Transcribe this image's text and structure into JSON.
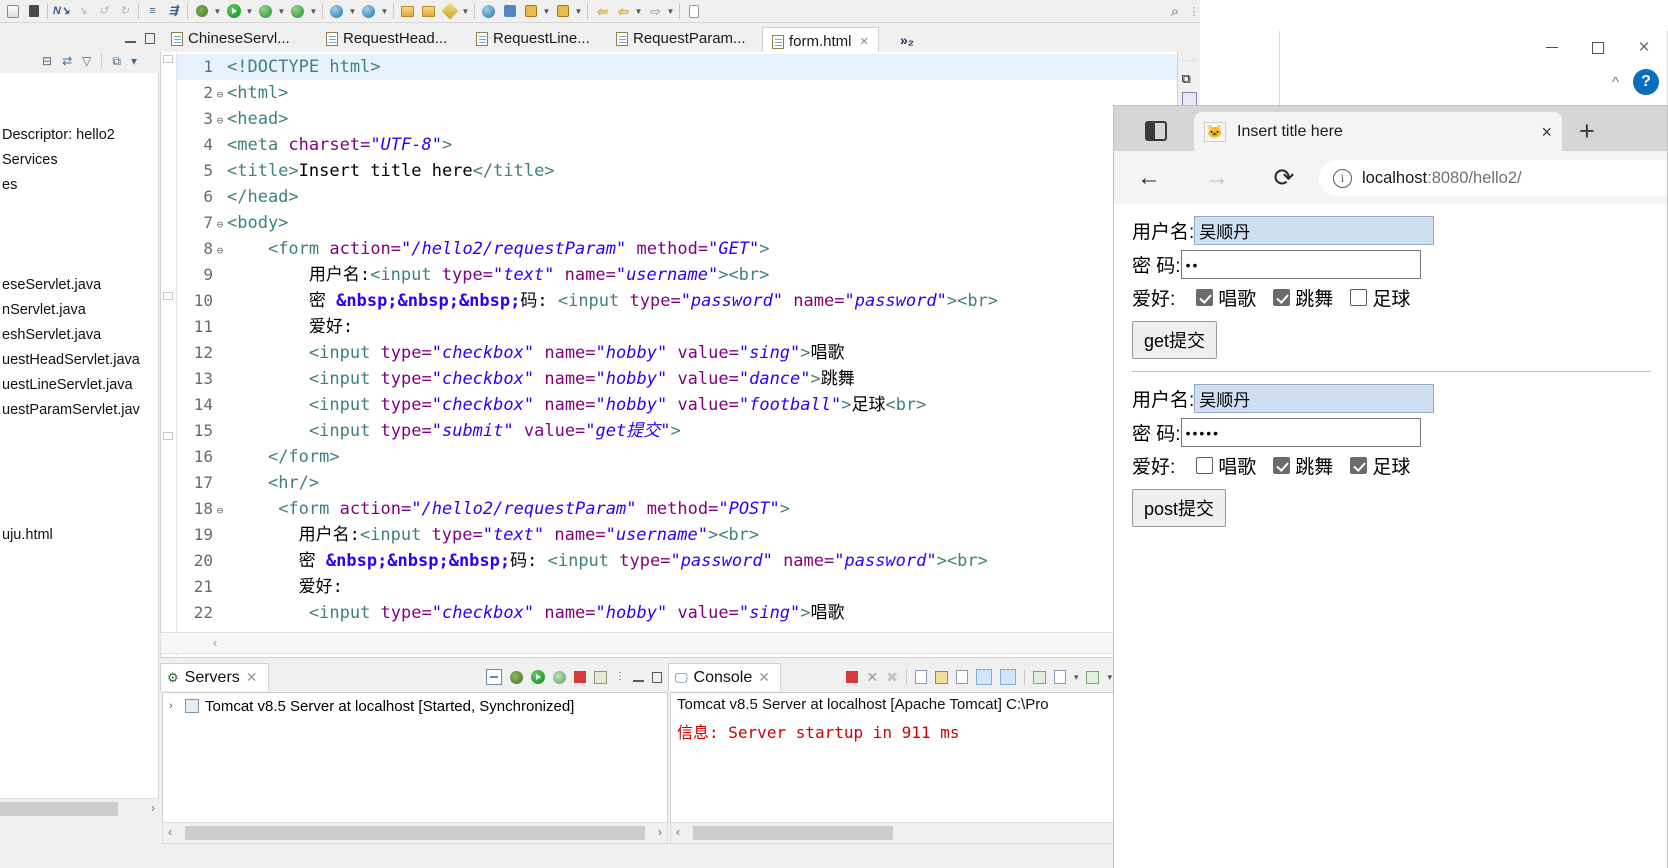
{
  "eclipse": {
    "toolbar": {
      "icons": [
        {
          "name": "restore-icon",
          "glyph": "bar"
        },
        {
          "name": "save-icon",
          "glyph": "dark"
        },
        {
          "name": "next-annotation-icon",
          "glyph": "nav"
        },
        {
          "name": "previous-annotation-icon",
          "glyph": "dis"
        },
        {
          "name": "undo-icon",
          "glyph": "dis"
        },
        {
          "name": "redo-icon",
          "glyph": "dis"
        },
        {
          "name": "open-task-icon",
          "glyph": "nav"
        },
        {
          "name": "skip-breakpoints-icon",
          "glyph": "nav"
        },
        {
          "name": "debug-icon",
          "glyph": "bug"
        },
        {
          "name": "run-icon",
          "glyph": "run"
        },
        {
          "name": "coverage-icon",
          "glyph": "green"
        },
        {
          "name": "profile-icon",
          "glyph": "green"
        },
        {
          "name": "new-server-icon",
          "glyph": "globe"
        },
        {
          "name": "web-browser-icon",
          "glyph": "globe"
        },
        {
          "name": "open-type-icon",
          "glyph": "folder"
        },
        {
          "name": "open-task-folder-icon",
          "glyph": "folder"
        },
        {
          "name": "edit-icon",
          "glyph": "pencil"
        },
        {
          "name": "search-globe-icon",
          "glyph": "globe"
        },
        {
          "name": "person-run-icon",
          "glyph": "blue"
        },
        {
          "name": "download-icon",
          "glyph": "yellow"
        },
        {
          "name": "upload-icon",
          "glyph": "yellow"
        },
        {
          "name": "back-history-icon",
          "glyph": "arrowL"
        },
        {
          "name": "forward-history-icon",
          "glyph": "arrowL"
        },
        {
          "name": "next-edit-icon",
          "glyph": "arrowG"
        },
        {
          "name": "new-window-icon",
          "glyph": "doc"
        }
      ],
      "search_icon": "search-icon",
      "overflow_dots": "⋮"
    },
    "explorer": {
      "rows": [
        "",
        "",
        "Descriptor: hello2",
        " Services",
        "es",
        "",
        "",
        "",
        "eseServlet.java",
        "nServlet.java",
        "eshServlet.java",
        "uestHeadServlet.java",
        "uestLineServlet.java",
        "uestParamServlet.jav",
        "",
        "",
        "",
        "",
        "uju.html"
      ]
    },
    "editor": {
      "tabs": [
        {
          "label": "ChineseServl...",
          "active": false,
          "close": false
        },
        {
          "label": "RequestHead...",
          "active": false,
          "close": false
        },
        {
          "label": "RequestLine...",
          "active": false,
          "close": false
        },
        {
          "label": "RequestParam...",
          "active": false,
          "close": false
        },
        {
          "label": "form.html",
          "active": true,
          "close": true
        }
      ],
      "more_tabs_label": "»₂",
      "lines": [
        {
          "no": "1",
          "fold": "",
          "current": true,
          "parts": [
            {
              "t": "dtd",
              "s": "<!DOCTYPE html>"
            }
          ]
        },
        {
          "no": "2",
          "fold": "⊖",
          "current": false,
          "parts": [
            {
              "t": "tag",
              "s": "<html>"
            }
          ]
        },
        {
          "no": "3",
          "fold": "⊖",
          "current": false,
          "parts": [
            {
              "t": "tag",
              "s": "<head>"
            }
          ]
        },
        {
          "no": "4",
          "fold": "",
          "current": false,
          "parts": [
            {
              "t": "tag",
              "s": "<meta "
            },
            {
              "t": "attr",
              "s": "charset="
            },
            {
              "t": "val",
              "s": "\"UTF-8\""
            },
            {
              "t": "tag",
              "s": ">"
            }
          ]
        },
        {
          "no": "5",
          "fold": "",
          "current": false,
          "parts": [
            {
              "t": "tag",
              "s": "<title>"
            },
            {
              "t": "txt",
              "s": "Insert title here"
            },
            {
              "t": "tag",
              "s": "</title>"
            }
          ]
        },
        {
          "no": "6",
          "fold": "",
          "current": false,
          "parts": [
            {
              "t": "tag",
              "s": "</head>"
            }
          ]
        },
        {
          "no": "7",
          "fold": "⊖",
          "current": false,
          "parts": [
            {
              "t": "tag",
              "s": "<body>"
            }
          ]
        },
        {
          "no": "8",
          "fold": "⊖",
          "current": false,
          "parts": [
            {
              "t": "txt",
              "s": "    "
            },
            {
              "t": "tag",
              "s": "<form "
            },
            {
              "t": "attr",
              "s": "action="
            },
            {
              "t": "val",
              "s": "\"/hello2/requestParam\""
            },
            {
              "t": "txt",
              "s": " "
            },
            {
              "t": "attr",
              "s": "method="
            },
            {
              "t": "val",
              "s": "\"GET\""
            },
            {
              "t": "tag",
              "s": ">"
            }
          ]
        },
        {
          "no": "9",
          "fold": "",
          "current": false,
          "parts": [
            {
              "t": "txt",
              "s": "        用户名:"
            },
            {
              "t": "tag",
              "s": "<input "
            },
            {
              "t": "attr",
              "s": "type="
            },
            {
              "t": "val",
              "s": "\"text\""
            },
            {
              "t": "txt",
              "s": " "
            },
            {
              "t": "attr",
              "s": "name="
            },
            {
              "t": "val",
              "s": "\"username\""
            },
            {
              "t": "tag",
              "s": "><br>"
            }
          ]
        },
        {
          "no": "10",
          "fold": "",
          "current": false,
          "parts": [
            {
              "t": "txt",
              "s": "        密 "
            },
            {
              "t": "ent",
              "s": "&nbsp;&nbsp;&nbsp;"
            },
            {
              "t": "txt",
              "s": "码: "
            },
            {
              "t": "tag",
              "s": "<input "
            },
            {
              "t": "attr",
              "s": "type="
            },
            {
              "t": "val",
              "s": "\"password\""
            },
            {
              "t": "txt",
              "s": " "
            },
            {
              "t": "attr",
              "s": "name="
            },
            {
              "t": "val",
              "s": "\"password\""
            },
            {
              "t": "tag",
              "s": "><br>"
            }
          ]
        },
        {
          "no": "11",
          "fold": "",
          "current": false,
          "parts": [
            {
              "t": "txt",
              "s": "        爱好:"
            }
          ]
        },
        {
          "no": "12",
          "fold": "",
          "current": false,
          "parts": [
            {
              "t": "txt",
              "s": "        "
            },
            {
              "t": "tag",
              "s": "<input "
            },
            {
              "t": "attr",
              "s": "type="
            },
            {
              "t": "val",
              "s": "\"checkbox\""
            },
            {
              "t": "txt",
              "s": " "
            },
            {
              "t": "attr",
              "s": "name="
            },
            {
              "t": "val",
              "s": "\"hobby\""
            },
            {
              "t": "txt",
              "s": " "
            },
            {
              "t": "attr",
              "s": "value="
            },
            {
              "t": "val",
              "s": "\"sing\""
            },
            {
              "t": "tag",
              "s": ">"
            },
            {
              "t": "txt",
              "s": "唱歌"
            }
          ]
        },
        {
          "no": "13",
          "fold": "",
          "current": false,
          "parts": [
            {
              "t": "txt",
              "s": "        "
            },
            {
              "t": "tag",
              "s": "<input "
            },
            {
              "t": "attr",
              "s": "type="
            },
            {
              "t": "val",
              "s": "\"checkbox\""
            },
            {
              "t": "txt",
              "s": " "
            },
            {
              "t": "attr",
              "s": "name="
            },
            {
              "t": "val",
              "s": "\"hobby\""
            },
            {
              "t": "txt",
              "s": " "
            },
            {
              "t": "attr",
              "s": "value="
            },
            {
              "t": "val",
              "s": "\"dance\""
            },
            {
              "t": "tag",
              "s": ">"
            },
            {
              "t": "txt",
              "s": "跳舞"
            }
          ]
        },
        {
          "no": "14",
          "fold": "",
          "current": false,
          "parts": [
            {
              "t": "txt",
              "s": "        "
            },
            {
              "t": "tag",
              "s": "<input "
            },
            {
              "t": "attr",
              "s": "type="
            },
            {
              "t": "val",
              "s": "\"checkbox\""
            },
            {
              "t": "txt",
              "s": " "
            },
            {
              "t": "attr",
              "s": "name="
            },
            {
              "t": "val",
              "s": "\"hobby\""
            },
            {
              "t": "txt",
              "s": " "
            },
            {
              "t": "attr",
              "s": "value="
            },
            {
              "t": "val",
              "s": "\"football\""
            },
            {
              "t": "tag",
              "s": ">"
            },
            {
              "t": "txt",
              "s": "足球"
            },
            {
              "t": "tag",
              "s": "<br>"
            }
          ]
        },
        {
          "no": "15",
          "fold": "",
          "current": false,
          "parts": [
            {
              "t": "txt",
              "s": "        "
            },
            {
              "t": "tag",
              "s": "<input "
            },
            {
              "t": "attr",
              "s": "type="
            },
            {
              "t": "val",
              "s": "\"submit\""
            },
            {
              "t": "txt",
              "s": " "
            },
            {
              "t": "attr",
              "s": "value="
            },
            {
              "t": "val",
              "s": "\"get提交\""
            },
            {
              "t": "tag",
              "s": ">"
            }
          ]
        },
        {
          "no": "16",
          "fold": "",
          "current": false,
          "parts": [
            {
              "t": "txt",
              "s": "    "
            },
            {
              "t": "tag",
              "s": "</form>"
            }
          ]
        },
        {
          "no": "17",
          "fold": "",
          "current": false,
          "parts": [
            {
              "t": "txt",
              "s": "    "
            },
            {
              "t": "tag",
              "s": "<hr/>"
            }
          ]
        },
        {
          "no": "18",
          "fold": "⊖",
          "current": false,
          "parts": [
            {
              "t": "txt",
              "s": "     "
            },
            {
              "t": "tag",
              "s": "<form "
            },
            {
              "t": "attr",
              "s": "action="
            },
            {
              "t": "val",
              "s": "\"/hello2/requestParam\""
            },
            {
              "t": "txt",
              "s": " "
            },
            {
              "t": "attr",
              "s": "method="
            },
            {
              "t": "val",
              "s": "\"POST\""
            },
            {
              "t": "tag",
              "s": ">"
            }
          ]
        },
        {
          "no": "19",
          "fold": "",
          "current": false,
          "parts": [
            {
              "t": "txt",
              "s": "       用户名:"
            },
            {
              "t": "tag",
              "s": "<input "
            },
            {
              "t": "attr",
              "s": "type="
            },
            {
              "t": "val",
              "s": "\"text\""
            },
            {
              "t": "txt",
              "s": " "
            },
            {
              "t": "attr",
              "s": "name="
            },
            {
              "t": "val",
              "s": "\"username\""
            },
            {
              "t": "tag",
              "s": "><br>"
            }
          ]
        },
        {
          "no": "20",
          "fold": "",
          "current": false,
          "parts": [
            {
              "t": "txt",
              "s": "       密 "
            },
            {
              "t": "ent",
              "s": "&nbsp;&nbsp;&nbsp;"
            },
            {
              "t": "txt",
              "s": "码: "
            },
            {
              "t": "tag",
              "s": "<input "
            },
            {
              "t": "attr",
              "s": "type="
            },
            {
              "t": "val",
              "s": "\"password\""
            },
            {
              "t": "txt",
              "s": " "
            },
            {
              "t": "attr",
              "s": "name="
            },
            {
              "t": "val",
              "s": "\"password\""
            },
            {
              "t": "tag",
              "s": "><br>"
            }
          ]
        },
        {
          "no": "21",
          "fold": "",
          "current": false,
          "parts": [
            {
              "t": "txt",
              "s": "       爱好:"
            }
          ]
        },
        {
          "no": "22",
          "fold": "",
          "current": false,
          "parts": [
            {
              "t": "txt",
              "s": "        "
            },
            {
              "t": "tag",
              "s": "<input "
            },
            {
              "t": "attr",
              "s": "type="
            },
            {
              "t": "val",
              "s": "\"checkbox\""
            },
            {
              "t": "txt",
              "s": " "
            },
            {
              "t": "attr",
              "s": "name="
            },
            {
              "t": "val",
              "s": "\"hobby\""
            },
            {
              "t": "txt",
              "s": " "
            },
            {
              "t": "attr",
              "s": "value="
            },
            {
              "t": "val",
              "s": "\"sing\""
            },
            {
              "t": "tag",
              "s": ">"
            },
            {
              "t": "txt",
              "s": "唱歌"
            }
          ]
        }
      ]
    },
    "servers_panel": {
      "title": "Servers",
      "server_row": "Tomcat v8.5 Server at localhost  [Started, Synchronized]"
    },
    "console_panel": {
      "title": "Console",
      "header_line": "Tomcat v8.5 Server at localhost [Apache Tomcat] C:\\Pro",
      "log_label": "信息:",
      "log_message": "Server startup in 911 ms"
    }
  },
  "background_window": {
    "minimize_label": "minimize",
    "maximize_label": "maximize",
    "close_label": "×",
    "chevron_label": "^",
    "help_label": "?"
  },
  "browser": {
    "tab": {
      "title": "Insert title here",
      "favicon": "tomcat-favicon",
      "close_label": "×"
    },
    "new_tab_label": "+",
    "nav": {
      "back_label": "←",
      "forward_label": "→",
      "reload_label": "⟳",
      "info_label": "i",
      "url_host": "localhost",
      "url_path": ":8080/hello2/"
    },
    "page": {
      "forms": [
        {
          "method": "GET",
          "username_label": "用户名:",
          "username_value": "吴顺丹",
          "username_selected": true,
          "password_label": "密  码:",
          "password_value": "••",
          "hobby_label": "爱好:",
          "hobbies": [
            {
              "label": "唱歌",
              "checked": true
            },
            {
              "label": "跳舞",
              "checked": true
            },
            {
              "label": "足球",
              "checked": false
            }
          ],
          "submit_label": "get提交"
        },
        {
          "method": "POST",
          "username_label": "用户名:",
          "username_value": "吴顺丹",
          "username_selected": true,
          "password_label": "密  码:",
          "password_value": "•••••",
          "hobby_label": "爱好:",
          "hobbies": [
            {
              "label": "唱歌",
              "checked": false
            },
            {
              "label": "跳舞",
              "checked": true
            },
            {
              "label": "足球",
              "checked": true
            }
          ],
          "submit_label": "post提交"
        }
      ]
    }
  }
}
